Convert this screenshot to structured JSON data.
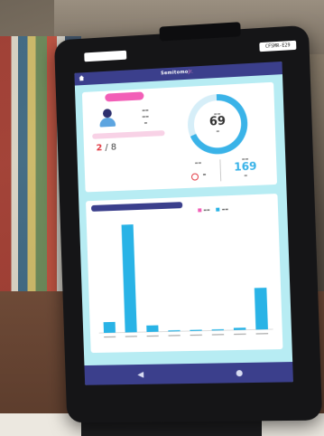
{
  "device_label": "CFSMR-E29",
  "app": {
    "title_main": "Semitomo",
    "title_accent": "Jr.",
    "accent_color": "#f25fb7",
    "bar_color": "#3b3f8c"
  },
  "panel_top": {
    "ring_value": "69",
    "ring_color": "#3ab3e8",
    "counter_value": "2",
    "counter_total": "/",
    "counter_total_value": "8",
    "stat_right_value": "169"
  },
  "chart_data": {
    "type": "bar",
    "title": "",
    "series": [
      {
        "values": [
          10,
          100,
          6,
          1,
          1,
          1,
          2,
          38
        ],
        "color": "#29b3e6"
      }
    ],
    "categories": [
      "",
      "",
      "",
      "",
      "",
      "",
      "",
      ""
    ],
    "ylim": [
      0,
      100
    ],
    "grid": false,
    "legend": "top-right"
  }
}
